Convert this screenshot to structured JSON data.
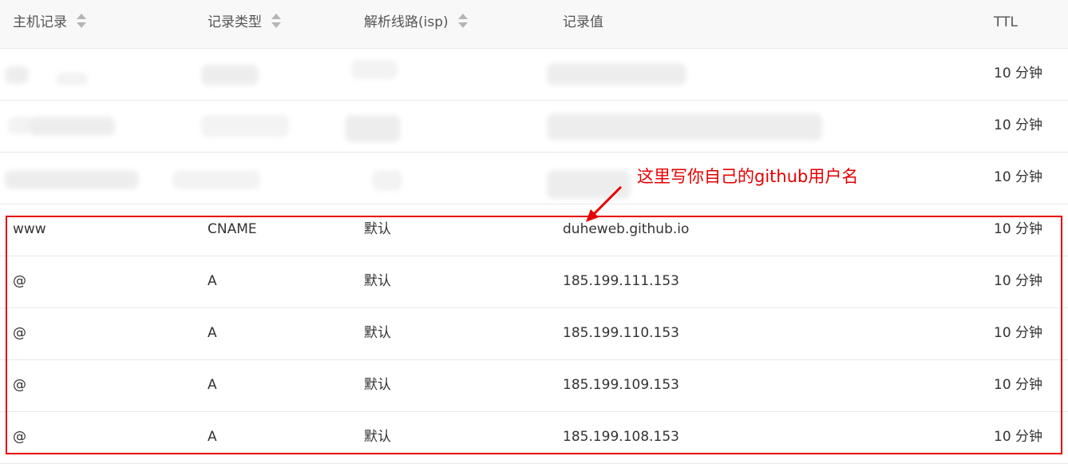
{
  "table": {
    "columns": [
      {
        "label": "主机记录",
        "sortable": true
      },
      {
        "label": "记录类型",
        "sortable": true
      },
      {
        "label": "解析线路(isp)",
        "sortable": true
      },
      {
        "label": "记录值",
        "sortable": false
      },
      {
        "label": "TTL",
        "sortable": false
      }
    ],
    "redacted_rows": [
      {
        "ttl": "10 分钟"
      },
      {
        "ttl": "10 分钟"
      },
      {
        "ttl": "10 分钟"
      }
    ],
    "rows": [
      {
        "host": "www",
        "type": "CNAME",
        "line": "默认",
        "value": "duheweb.github.io",
        "ttl": "10 分钟"
      },
      {
        "host": "@",
        "type": "A",
        "line": "默认",
        "value": "185.199.111.153",
        "ttl": "10 分钟"
      },
      {
        "host": "@",
        "type": "A",
        "line": "默认",
        "value": "185.199.110.153",
        "ttl": "10 分钟"
      },
      {
        "host": "@",
        "type": "A",
        "line": "默认",
        "value": "185.199.109.153",
        "ttl": "10 分钟"
      },
      {
        "host": "@",
        "type": "A",
        "line": "默认",
        "value": "185.199.108.153",
        "ttl": "10 分钟"
      }
    ]
  },
  "annotation": {
    "text": "这里写你自己的github用户名",
    "color": "#e60000"
  },
  "icons": {
    "sort": "sort-icon",
    "arrow": "arrow-icon"
  }
}
